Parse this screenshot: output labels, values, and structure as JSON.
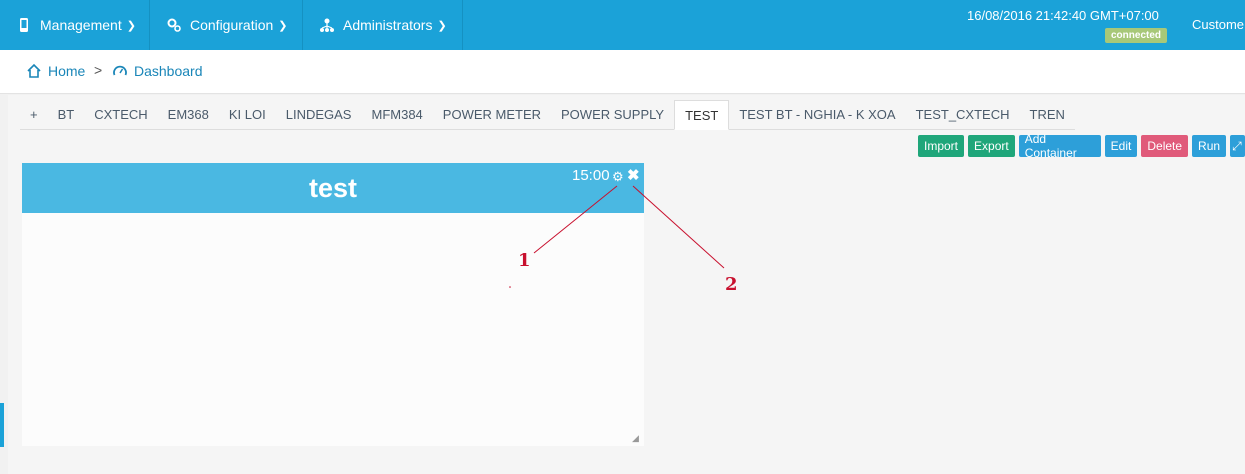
{
  "navbar": {
    "items": [
      {
        "label": "Management"
      },
      {
        "label": "Configuration"
      },
      {
        "label": "Administrators"
      }
    ],
    "datetime": "16/08/2016 21:42:40 GMT+07:00",
    "status_badge": "connected",
    "customer": "Custome"
  },
  "breadcrumb": {
    "home": "Home",
    "separator": ">",
    "current": "Dashboard"
  },
  "tabs": [
    "+",
    "BT",
    "CXTECH",
    "EM368",
    "KI LOI",
    "LINDEGAS",
    "MFM384",
    "POWER METER",
    "POWER SUPPLY",
    "TEST",
    "TEST BT - NGHIA - K XOA",
    "TEST_CXTECH",
    "TREN"
  ],
  "active_tab": "TEST",
  "toolbar": {
    "import": "Import",
    "export": "Export",
    "add_container": "Add Container",
    "edit": "Edit",
    "delete": "Delete",
    "run": "Run"
  },
  "widget": {
    "title": "test",
    "time": "15:00"
  },
  "annotations": {
    "one": "1",
    "two": "2"
  },
  "colors": {
    "navbar": "#1ba2d8",
    "widget_header": "#4ab8e2",
    "green_button": "#1fa67a",
    "blue_button": "#2d9fd9",
    "red_button": "#e05a7a",
    "badge": "#a8c878",
    "annotation": "#c8102e"
  }
}
